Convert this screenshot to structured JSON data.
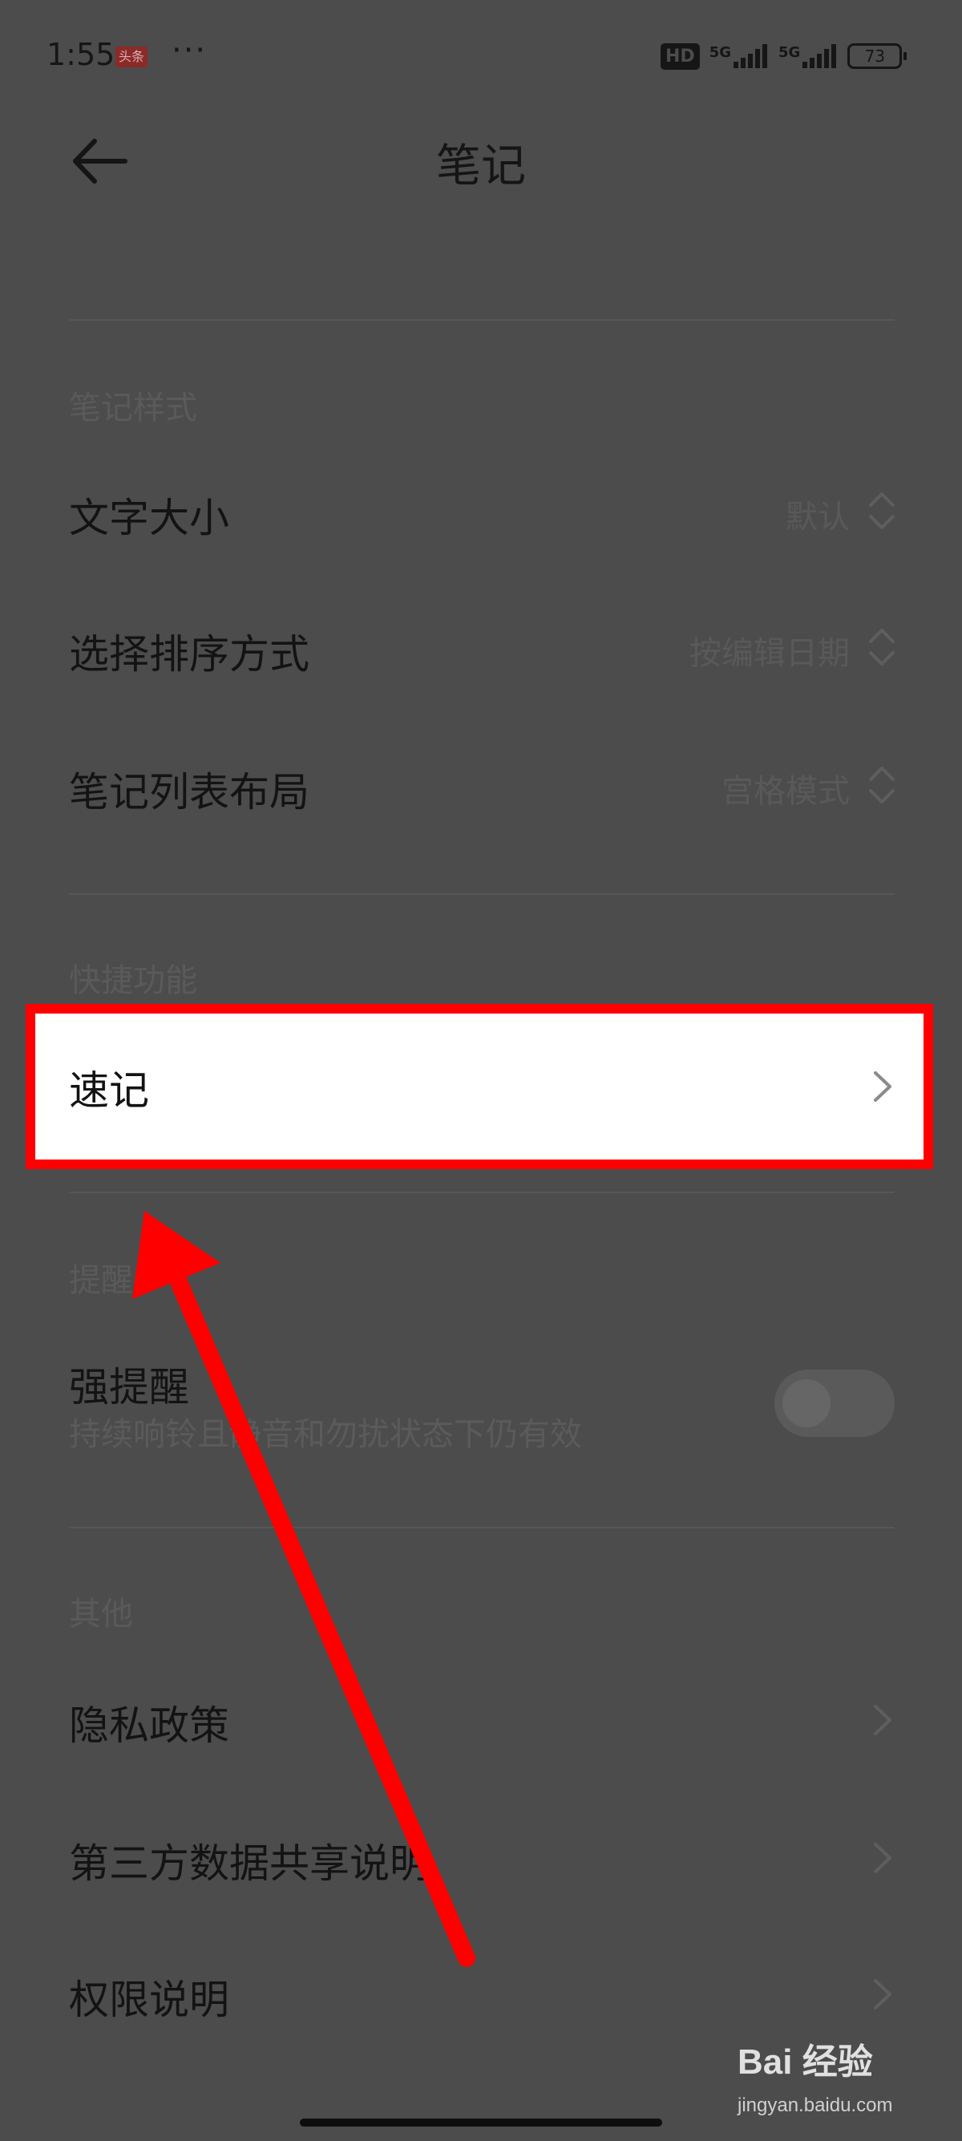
{
  "status_bar": {
    "time": "1:55",
    "app_badge": "头条",
    "more": "···",
    "hd_label": "HD",
    "net1": "5G",
    "net2": "5G",
    "battery": "73",
    "icons": [
      "hd-icon",
      "signal-icon",
      "signal-icon",
      "battery-icon"
    ]
  },
  "header": {
    "title": "笔记",
    "back_icon": "arrow-left-icon"
  },
  "style_section": {
    "title": "笔记样式",
    "items": [
      {
        "label": "文字大小",
        "value": "默认"
      },
      {
        "label": "选择排序方式",
        "value": "按编辑日期"
      },
      {
        "label": "笔记列表布局",
        "value": "宫格模式"
      }
    ]
  },
  "shortcut_section": {
    "title": "快捷功能",
    "items": [
      {
        "label": "速记"
      }
    ]
  },
  "reminder_section": {
    "title": "提醒",
    "item": {
      "label": "强提醒",
      "subtext": "持续响铃且静音和勿扰状态下仍有效",
      "toggle_on": false
    }
  },
  "other_section": {
    "title": "其他",
    "items": [
      {
        "label": "隐私政策"
      },
      {
        "label": "第三方数据共享说明"
      },
      {
        "label": "权限说明"
      }
    ]
  },
  "watermark": {
    "logo": "Bai 经验",
    "url": "jingyan.baidu.com"
  },
  "colors": {
    "overlay_bg": "#4c4c4c",
    "highlight": "#ff0000",
    "highlight_fill": "#ffffff"
  }
}
